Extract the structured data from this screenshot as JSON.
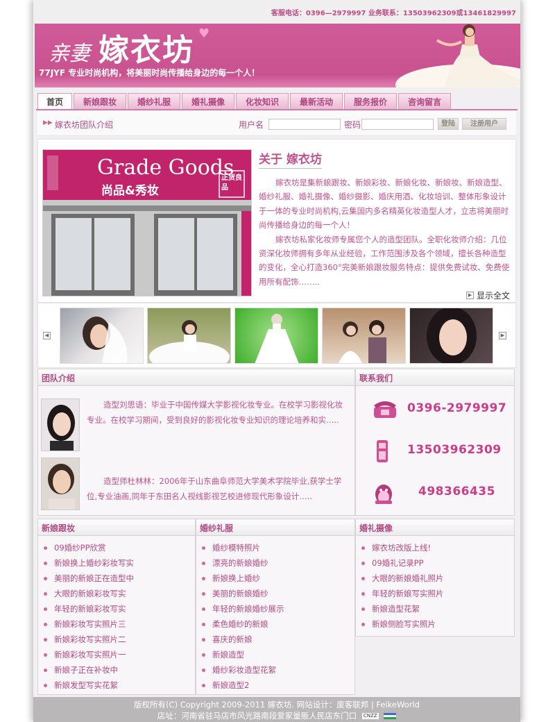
{
  "topbar": {
    "contact": "客服电话：0396—2979997  业务联系：13503962309或13461829997"
  },
  "banner": {
    "logo_small": "亲妻",
    "logo_big": "嫁衣坊",
    "slogan": "77JYF 专业时尚机构，将美丽时尚传播给身边的每一个人！"
  },
  "nav": {
    "tabs": [
      "首页",
      "新娘跟妆",
      "婚纱礼服",
      "婚礼摄像",
      "化妆知识",
      "最新活动",
      "服务报价",
      "咨询留言"
    ]
  },
  "login": {
    "team_link": "嫁衣坊团队介绍",
    "username_label": "用户名",
    "password_label": "密码",
    "login_button": "登陆",
    "register_button": "注册用户"
  },
  "about": {
    "shop_sign": "Grade Goods",
    "shop_sub": "尚品&秀妆",
    "shop_badge": "正货良品",
    "title": "关于 嫁衣坊",
    "para1": "嫁衣坊是集新娘跟妆、新娘彩妆、新娘化妆、新娘妆、新娘造型、婚纱礼服、婚礼摄像、婚纱摄影、婚庆用酒、化妆培训、整体形象设计于一体的专业时尚机构,云集国内多名精英化妆造型人才，立志将美丽时尚传播给身边的每一个人！",
    "para2": "嫁衣坊私家化妆师专属您个人的造型团队。全职化妆师介绍：几位资深化妆师拥有多年从业经验，工作范围涉及各个领域，擅长各种造型的变化，全心打造360°完美新娘跟妆服务特点：提供免费试妆、免费使用所有配饰……..",
    "more": "显示全文"
  },
  "team": {
    "title": "团队介绍",
    "members": [
      {
        "text": "造型刘思语：毕业于中国传媒大学影视化妆专业。在校学习影视化妆专业。在校学习期间，受到良好的影视化妆专业知识的理论培养和实….."
      },
      {
        "text": "造型师杜林林：2006年于山东曲阜师范大学美术学院毕业,获学士学位,专业油画,同年于东田名人视线影视艺校进修现代形象设计….."
      }
    ]
  },
  "contact": {
    "title": "联系我们",
    "phone": "0396-2979997",
    "mobile": "13503962309",
    "qq": "498366435",
    "phone_icon": "telephone-icon",
    "mobile_icon": "mobile-phone-icon",
    "qq_icon": "qq-penguin-icon"
  },
  "columns": [
    {
      "title": "新娘跟妆",
      "items": [
        "09婚纱PP欣赏",
        "新娘换上婚纱彩妆写实",
        "美丽的新娘正在造型中",
        "大眼的新娘彩妆写实",
        "年轻的新娘彩妆写实",
        "新娘彩妆写实照片三",
        "新娘彩妆写实照片二",
        "新娘彩妆写实照片一",
        "新娘子正在补妆中",
        "新娘发型写实花絮"
      ]
    },
    {
      "title": "婚纱礼服",
      "items": [
        "婚纱模特照片",
        "漂亮的新娘婚纱",
        "新娘换上婚纱",
        "美丽的新娘婚纱",
        "年轻的新娘婚纱展示",
        "柔色婚纱的新娘",
        "喜庆的新娘",
        "新娘造型",
        "婚纱彩妆造型花絮",
        "新娘造型2"
      ]
    },
    {
      "title": "婚礼摄像",
      "items": [
        "嫁衣坊改版上线!",
        "09婚礼记录PP",
        "大眼的新娘婚礼照片",
        "年轻的新娘写实照片",
        "新娘造型花絮",
        "新娘侧脸写实照片"
      ]
    }
  ],
  "footer": {
    "line1": "版权所有(C) Copyright 2009-2011 嫁衣坊.      网站设计：废客联邦 | FeikeWorld",
    "line2": "店址：河南省驻马店市风光路南段爱家量贩人民店东门口",
    "badge": "CNZZ"
  },
  "colors": {
    "brand": "#c9528f",
    "accent_text": "#c0528e",
    "phone_digits": "#c93d89"
  }
}
